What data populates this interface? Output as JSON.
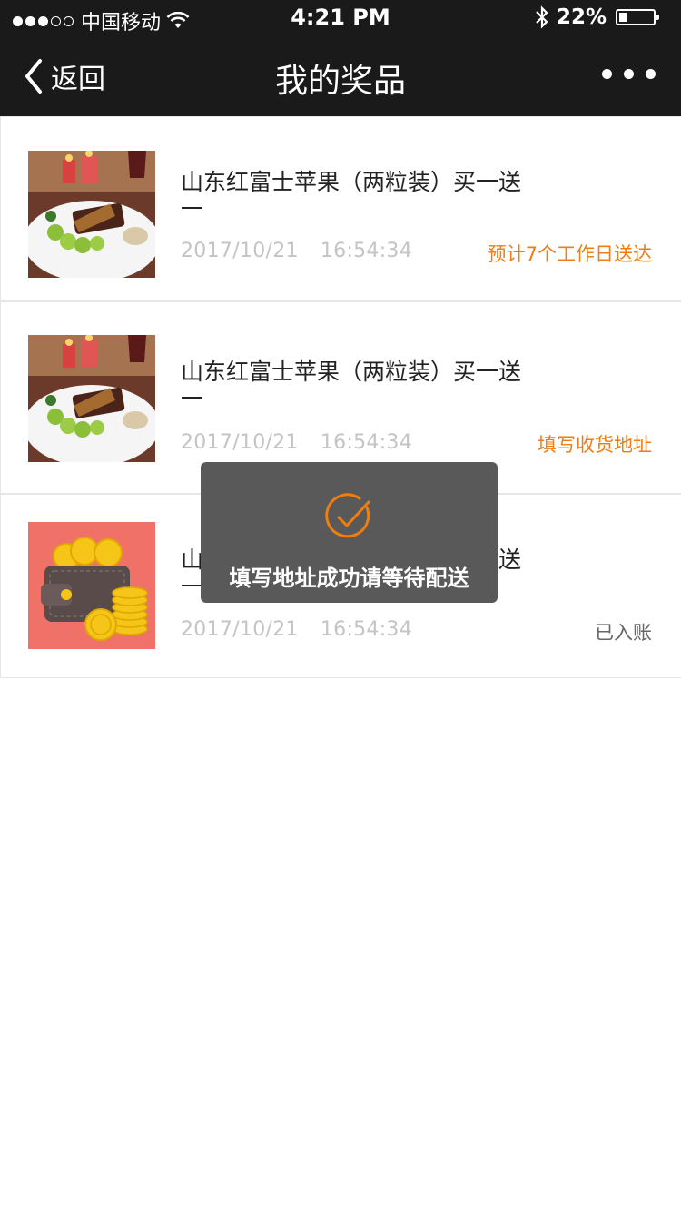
{
  "status_bar": {
    "carrier": "中国移动",
    "time": "4:21 PM",
    "battery": "22%",
    "battery_level": 0.22
  },
  "nav": {
    "back_label": "返回",
    "title": "我的奖品"
  },
  "items": [
    {
      "title": "山东红富士苹果（两粒装）买一送一",
      "date": "2017/10/21",
      "time": "16:54:34",
      "status": "预计7个工作日送达",
      "status_color": "#f07d0f",
      "image": "food-plate-image"
    },
    {
      "title": "山东红富士苹果（两粒装）买一送一",
      "date": "2017/10/21",
      "time": "16:54:34",
      "status": "填写收货地址",
      "status_color": "#f07d0f",
      "image": "food-plate-image"
    },
    {
      "title": "山东红富士苹果（两粒装）买一送一",
      "date": "2017/10/21",
      "time": "16:54:34",
      "status": "已入账",
      "status_color": "#666666",
      "image": "wallet-coins-image"
    }
  ],
  "toast": {
    "message": "填写地址成功请等待配送",
    "icon": "check-circle-icon"
  },
  "colors": {
    "bar_bg": "#1a1a1a",
    "accent": "#f07d0f",
    "toast_bg": "#595959",
    "wallet_bg": "#f07167"
  }
}
